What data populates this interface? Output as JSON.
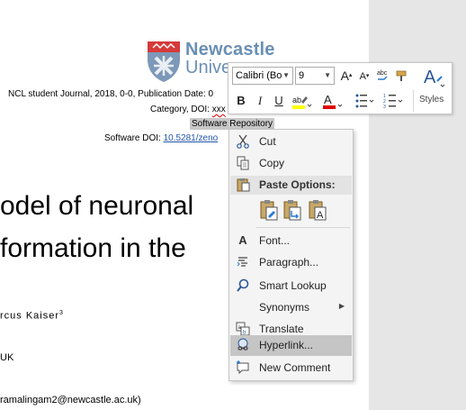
{
  "document": {
    "logo": {
      "line1": "Newcastle",
      "line2": "Unive"
    },
    "meta": {
      "journal_line": "NCL student Journal, 2018, 0-0, Publication Date: 0",
      "category_prefix": "Category, DOI: ",
      "category_doi": "xxx",
      "software_repository": "Software Repository",
      "software_doi_prefix": "Software DOI: ",
      "software_doi_link": "10.5281/zeno"
    },
    "title_line1": "odel of neuronal",
    "title_line2": "formation in the",
    "author_line": "rcus Kaiser",
    "author_sup": "3",
    "affil_line": "UK",
    "email_line": "ramalingam2@newcastle.ac.uk)"
  },
  "minibar": {
    "font_name": "Calibri (Bo",
    "font_size": "9",
    "grow_font": "A",
    "shrink_font": "A",
    "bold": "B",
    "italic": "I",
    "underline": "U",
    "styles_label": "Styles",
    "highlight_color": "#ffff00",
    "font_color": "#e00000"
  },
  "context_menu": {
    "cut": "Cut",
    "copy": "Copy",
    "paste_options": "Paste Options:",
    "font": "Font...",
    "paragraph": "Paragraph...",
    "smart_lookup": "Smart Lookup",
    "synonyms": "Synonyms",
    "translate": "Translate",
    "hyperlink": "Hyperlink...",
    "new_comment": "New Comment"
  }
}
